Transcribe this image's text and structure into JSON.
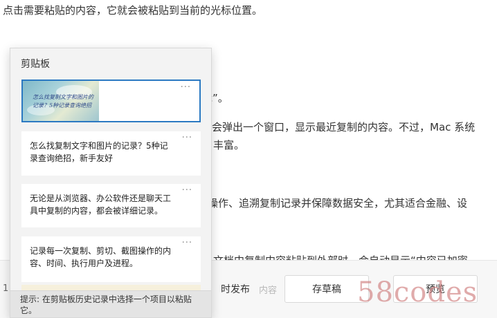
{
  "article": {
    "line1": "点击需要粘贴的内容，它就会被粘贴到当前的光标位置。",
    "line2": "辑”。",
    "line3": "会弹出一个窗口，显示最近复制的内容。不过，Mac 系统",
    "line4": "丰富。",
    "line5": "操作、追溯复制记录并保障数据安全，尤其适合金融、设",
    "line6": "文档中复制内容粘贴到外部时，会自动显示“内容已加密"
  },
  "bottom_bar": {
    "left_text": "1",
    "publish_label": "时发布",
    "faded_label": "内容",
    "draft_label": "存草稿",
    "preview_label": "预览"
  },
  "watermark": "58codes",
  "clipboard": {
    "title": "剪贴板",
    "more_icon": "···",
    "items": [
      {
        "type": "image",
        "image_text": "怎么找复制文字和图片的记录？5种记录查询绝招"
      },
      {
        "type": "text",
        "text": "怎么找复制文字和图片的记录？5种记录查询绝招，新手友好"
      },
      {
        "type": "text",
        "text": "无论是从浏览器、办公软件还是聊天工具中复制的内容，都会被详细记录。"
      },
      {
        "type": "text",
        "text": "记录每一次复制、剪切、截图操作的内容、时间、执行用户及进程。"
      }
    ],
    "footer_hint": "提示: 在剪贴板历史记录中选择一个项目以粘贴它。"
  },
  "colors": {
    "selection_border": "#2b79c2",
    "panel_background": "#f3f3f3",
    "watermark": "#cd7878"
  }
}
